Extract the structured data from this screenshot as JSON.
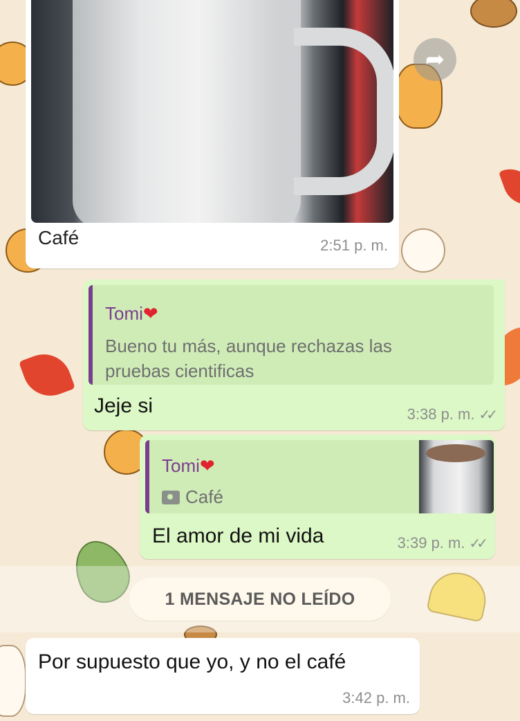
{
  "messages": [
    {
      "type": "image",
      "direction": "incoming",
      "caption": "Café",
      "time": "2:51 p. m."
    },
    {
      "type": "reply",
      "direction": "outgoing",
      "quote_author": "Tomi",
      "quote_heart": "❤",
      "quote_text_line1": "Bueno tu más, aunque rechazas las",
      "quote_text_line2": "pruebas cientificas",
      "text": "Jeje si",
      "time": "3:38 p. m.",
      "status_icon": "double-check-icon"
    },
    {
      "type": "reply",
      "direction": "outgoing",
      "quote_author": "Tomi",
      "quote_heart": "❤",
      "quote_text": "Café",
      "quote_media_icon": "camera-icon",
      "text": "El amor de mi vida",
      "time": "3:39 p. m.",
      "status_icon": "double-check-icon"
    },
    {
      "type": "text",
      "direction": "incoming",
      "text": "Por supuesto que yo, y no el café",
      "time": "3:42 p. m."
    }
  ],
  "unread_banner": "1 MENSAJE NO LEÍDO",
  "forward_icon": "forward-icon",
  "ticks_glyph": "✓✓",
  "colors": {
    "outgoing_bubble": "#dcf8c6",
    "incoming_bubble": "#ffffff",
    "quote_accent": "#7b3d8e",
    "wallpaper": "#f6ead6"
  }
}
